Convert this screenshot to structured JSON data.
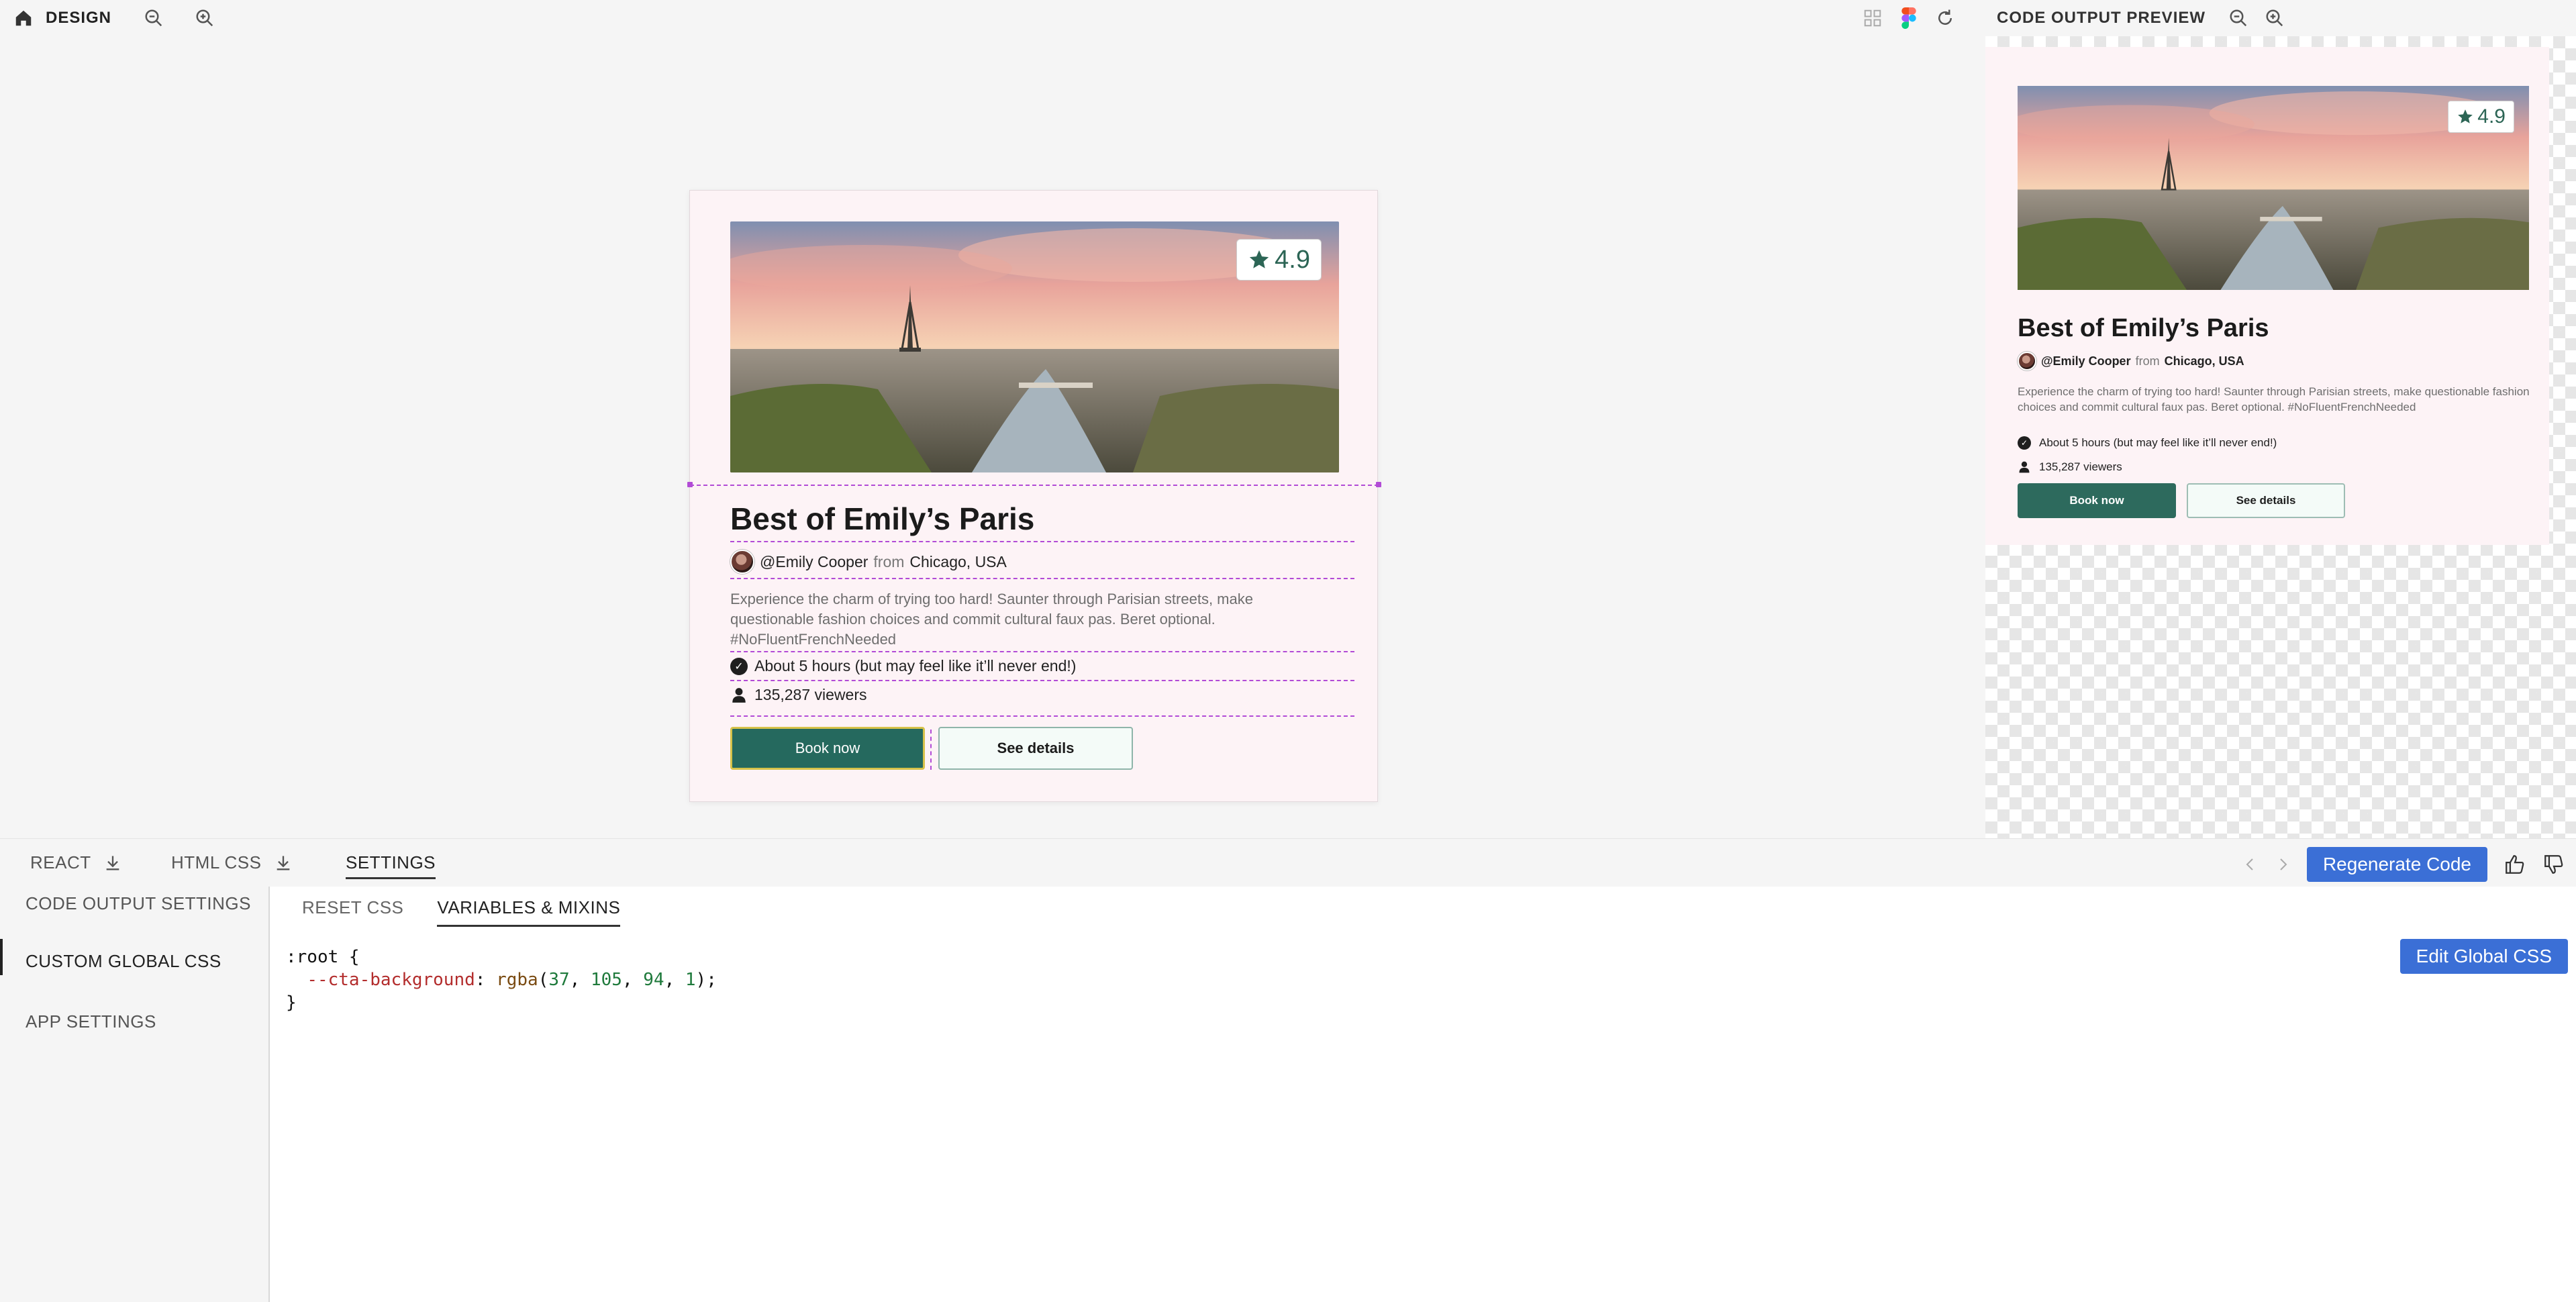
{
  "toolbar": {
    "title": "DESIGN",
    "icons": [
      "home-icon",
      "zoom-out-icon",
      "zoom-in-icon",
      "grid-icon",
      "figma-icon",
      "refresh-icon"
    ]
  },
  "preview_header": {
    "title": "CODE OUTPUT PREVIEW"
  },
  "design_card": {
    "rating": "4.9",
    "title": "Best of Emily’s Paris",
    "author": "@Emily Cooper",
    "from_word": "from",
    "location": "Chicago, USA",
    "description": "Experience the charm of trying too hard! Saunter through Parisian streets, make questionable fashion choices and commit cultural faux pas. Beret optional. #NoFluentFrenchNeeded",
    "duration": "About 5 hours (but may feel like it’ll never end!)",
    "viewers": "135,287 viewers",
    "primary_button": "Book now",
    "secondary_button": "See details"
  },
  "preview_card": {
    "rating": "4.9",
    "title": "Best of Emily’s Paris",
    "author": "@Emily Cooper",
    "from_word": "from",
    "location": "Chicago, USA",
    "description": "Experience the charm of trying too hard! Saunter through Parisian streets, make questionable fashion choices and commit cultural faux pas. Beret optional. #NoFluentFrenchNeeded",
    "duration": "About 5 hours (but may feel like it’ll never end!)",
    "viewers": "135,287 viewers",
    "primary_button": "Book now",
    "secondary_button": "See details"
  },
  "bottom_tabs": {
    "react": "REACT",
    "html_css": "HTML CSS",
    "settings": "SETTINGS",
    "regenerate": "Regenerate Code"
  },
  "settings_menu": {
    "items": [
      "CODE OUTPUT SETTINGS",
      "CUSTOM GLOBAL CSS",
      "APP SETTINGS"
    ],
    "active": "CUSTOM GLOBAL CSS"
  },
  "editor": {
    "sub_tabs": [
      "RESET CSS",
      "VARIABLES & MIXINS"
    ],
    "active_sub_tab": "VARIABLES & MIXINS",
    "code": {
      "line1": ":root {",
      "prop": "--cta-background",
      "func": "rgba",
      "args": [
        "37",
        "105",
        "94",
        "1"
      ],
      "line3": "}"
    },
    "edit_button": "Edit Global CSS"
  },
  "colors": {
    "cta": "#25695e",
    "accent_blue": "#3b6fd6",
    "guide": "#b24bd6",
    "card_bg": "#fdf3f6"
  }
}
